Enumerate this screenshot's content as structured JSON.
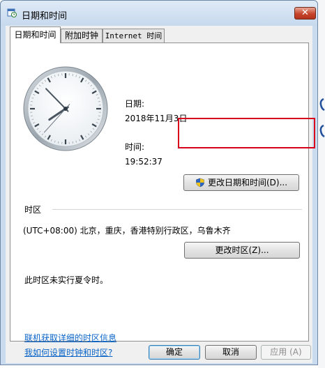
{
  "window": {
    "title": "日期和时间"
  },
  "tabs": [
    {
      "label": "日期和时间",
      "active": true
    },
    {
      "label": "附加时钟",
      "active": false
    },
    {
      "label": "Internet 时间",
      "active": false
    }
  ],
  "datetime": {
    "date_label": "日期:",
    "date_value": "2018年11月3日",
    "time_label": "时间:",
    "time_value": "19:52:37",
    "change_button": "更改日期和时间(D)..."
  },
  "timezone": {
    "section_label": "时区",
    "value": "(UTC+08:00) 北京，重庆，香港特别行政区，乌鲁木齐",
    "change_button": "更改时区(Z)...",
    "dst_note": "此时区未实行夏令时。"
  },
  "links": {
    "timezone_info": "联机获取详细的时区信息",
    "how_to_set": "我如何设置时钟和时区?"
  },
  "footer": {
    "ok": "确定",
    "cancel": "取消",
    "apply": "应用 (A)"
  },
  "colors": {
    "highlight": "#d9001b",
    "link": "#0a64c8"
  }
}
